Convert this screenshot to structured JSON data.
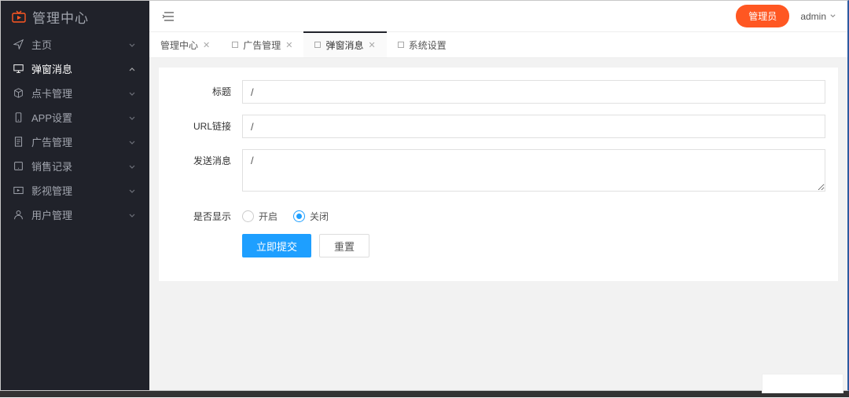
{
  "brand": {
    "title": "管理中心"
  },
  "sidebar": {
    "items": [
      {
        "label": "主页",
        "icon": "plane"
      },
      {
        "label": "弹窗消息",
        "icon": "monitor",
        "active": true
      },
      {
        "label": "点卡管理",
        "icon": "cube"
      },
      {
        "label": "APP设置",
        "icon": "phone"
      },
      {
        "label": "广告管理",
        "icon": "doc"
      },
      {
        "label": "销售记录",
        "icon": "tablet"
      },
      {
        "label": "影视管理",
        "icon": "video"
      },
      {
        "label": "用户管理",
        "icon": "user"
      }
    ]
  },
  "topbar": {
    "badge": "管理员",
    "user": "admin"
  },
  "tabs": [
    {
      "label": "管理中心",
      "closable": true,
      "marker": false
    },
    {
      "label": "广告管理",
      "closable": true,
      "marker": true
    },
    {
      "label": "弹窗消息",
      "closable": true,
      "marker": true,
      "active": true
    },
    {
      "label": "系统设置",
      "closable": false,
      "marker": true
    }
  ],
  "form": {
    "title_label": "标题",
    "title_value": "/",
    "url_label": "URL链接",
    "url_value": "/",
    "msg_label": "发送消息",
    "msg_value": "/",
    "show_label": "是否显示",
    "radio_on": "开启",
    "radio_off": "关闭",
    "radio_selected": "off",
    "submit": "立即提交",
    "reset": "重置"
  }
}
